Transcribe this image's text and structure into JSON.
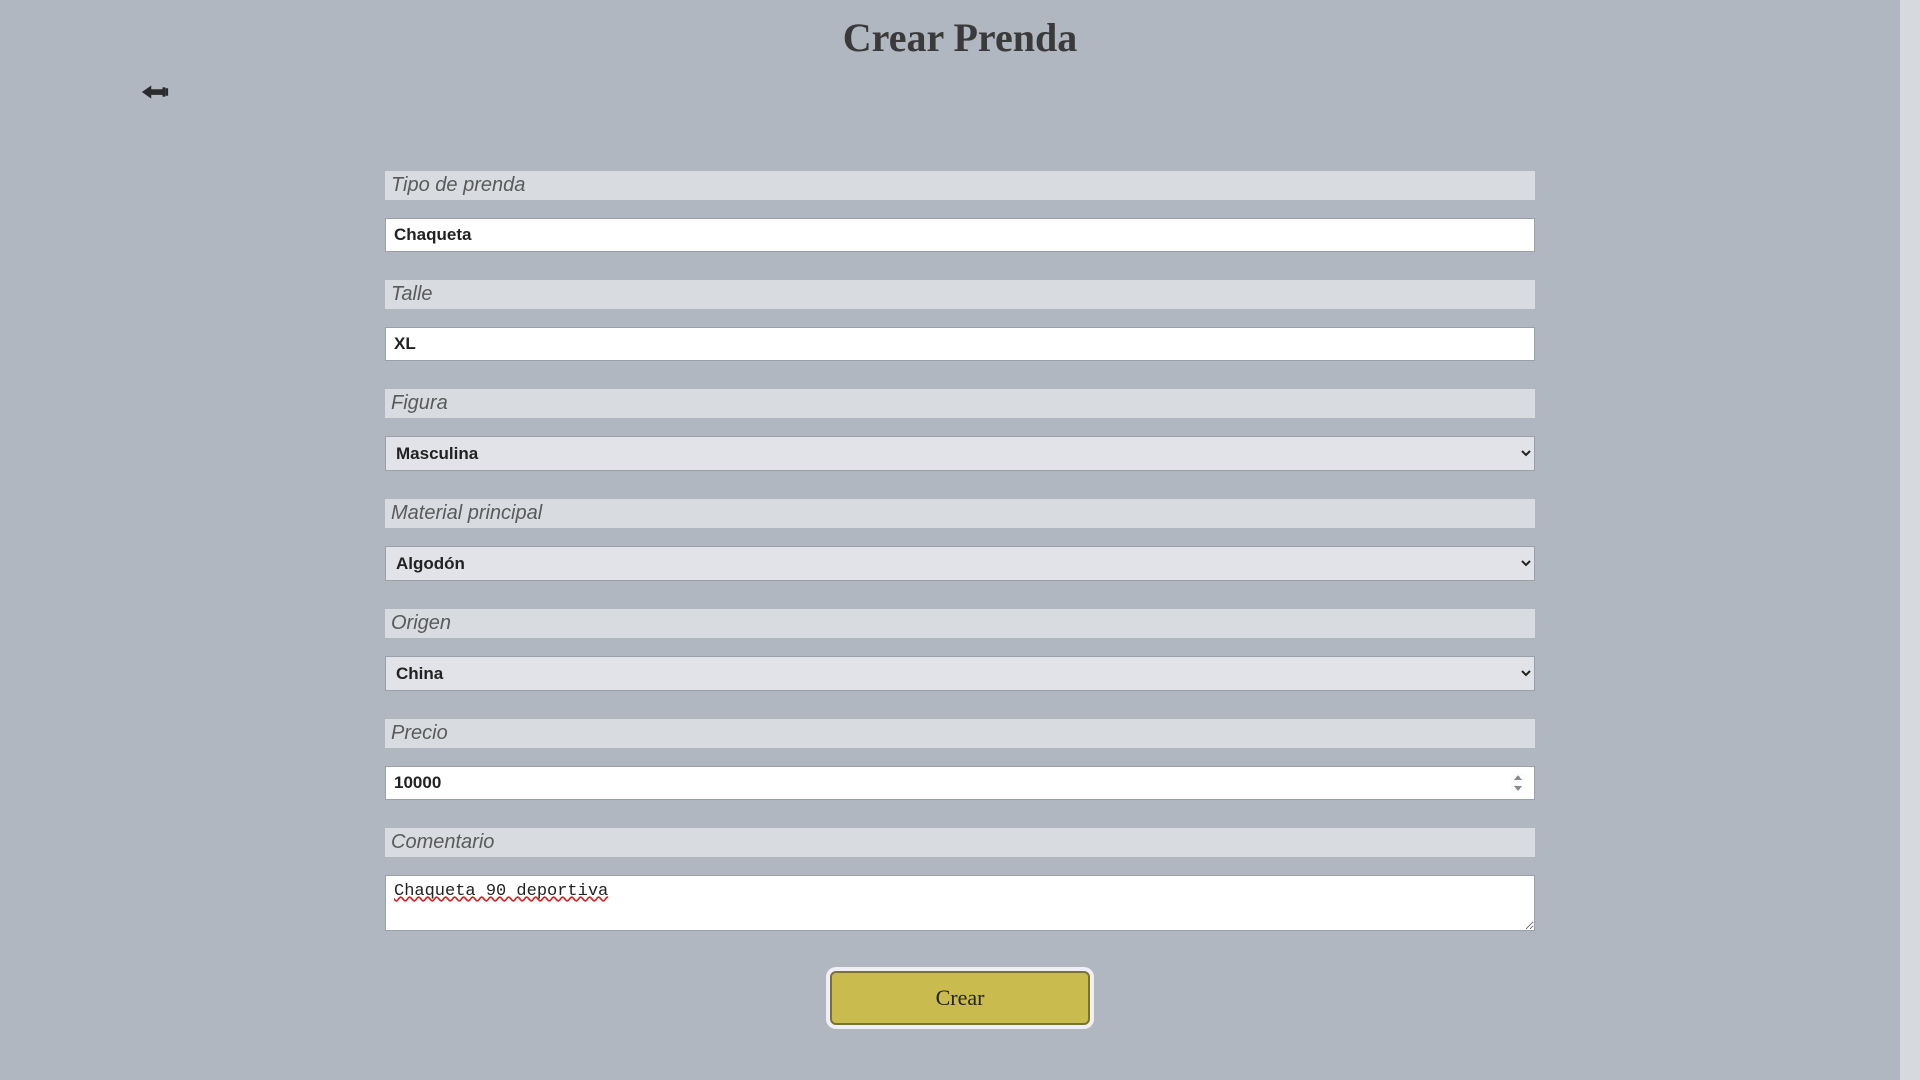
{
  "page": {
    "title": "Crear Prenda"
  },
  "form": {
    "tipo_label": "Tipo de prenda",
    "tipo_value": "Chaqueta",
    "talle_label": "Talle",
    "talle_value": "XL",
    "figura_label": "Figura",
    "figura_value": "Masculina",
    "figura_options": [
      "Masculina"
    ],
    "material_label": "Material principal",
    "material_value": "Algodón",
    "material_options": [
      "Algodón"
    ],
    "origen_label": "Origen",
    "origen_value": "China",
    "origen_options": [
      "China"
    ],
    "precio_label": "Precio",
    "precio_value": "10000",
    "comentario_label": "Comentario",
    "comentario_value": "Chaqueta 90 deportiva"
  },
  "actions": {
    "create_label": "Crear"
  },
  "icons": {
    "back": "hand-point-left-icon"
  }
}
